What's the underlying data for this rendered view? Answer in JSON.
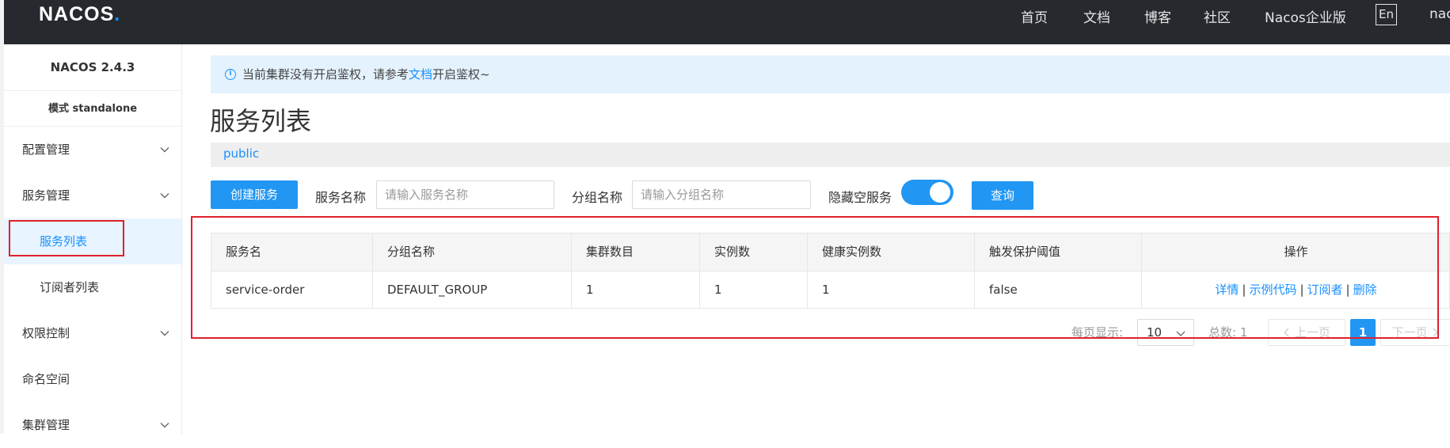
{
  "header": {
    "logo": "NACOS",
    "nav": [
      "首页",
      "文档",
      "博客",
      "社区",
      "Nacos企业版"
    ],
    "lang": "En",
    "user_partial": "nac"
  },
  "sidebar": {
    "version": "NACOS 2.4.3",
    "mode": "模式 standalone",
    "items": [
      {
        "label": "配置管理",
        "expandable": true
      },
      {
        "label": "服务管理",
        "expandable": true
      },
      {
        "label": "服务列表",
        "active": true
      },
      {
        "label": "订阅者列表"
      },
      {
        "label": "权限控制",
        "expandable": true
      },
      {
        "label": "命名空间"
      },
      {
        "label": "集群管理",
        "expandable": true
      }
    ]
  },
  "notice": {
    "text_before": "当前集群没有开启鉴权，请参考",
    "link": "文档",
    "text_after": "开启鉴权~"
  },
  "page": {
    "title": "服务列表",
    "namespace": "public"
  },
  "toolbar": {
    "create_button": "创建服务",
    "service_name_label": "服务名称",
    "service_name_placeholder": "请输入服务名称",
    "group_name_label": "分组名称",
    "group_name_placeholder": "请输入分组名称",
    "hide_empty_label": "隐藏空服务",
    "hide_empty_on": true,
    "query_button": "查询"
  },
  "table": {
    "headers": [
      "服务名",
      "分组名称",
      "集群数目",
      "实例数",
      "健康实例数",
      "触发保护阈值",
      "操作"
    ],
    "rows": [
      {
        "cells": [
          "service-order",
          "DEFAULT_GROUP",
          "1",
          "1",
          "1",
          "false"
        ],
        "actions": [
          "详情",
          "示例代码",
          "订阅者",
          "删除"
        ]
      }
    ]
  },
  "pagination": {
    "page_size_label": "每页显示:",
    "page_size": "10",
    "total_label": "总数: 1",
    "prev": "上一页",
    "current": "1",
    "next": "下一页"
  },
  "colors": {
    "accent": "#2196f3",
    "header_bg": "#262a2f",
    "highlight_border": "#e0202b"
  }
}
